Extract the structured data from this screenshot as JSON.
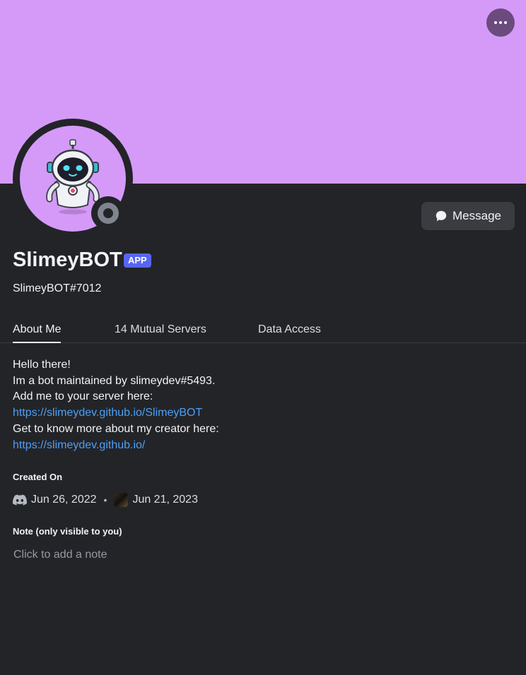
{
  "profile": {
    "display_name": "SlimeyBOT",
    "badge": "APP",
    "username": "SlimeyBOT#7012",
    "banner_color": "#d59af8",
    "status": "offline"
  },
  "actions": {
    "message_label": "Message",
    "more_icon": "ellipsis-icon"
  },
  "tabs": [
    {
      "label": "About Me",
      "active": true
    },
    {
      "label": "14 Mutual Servers",
      "active": false
    },
    {
      "label": "Data Access",
      "active": false
    }
  ],
  "about": {
    "line1": "Hello there!",
    "line2": "Im a bot maintained by slimeydev#5493.",
    "line3": "Add me to your server here:",
    "link1": "https://slimeydev.github.io/SlimeyBOT",
    "line4": "Get to know more about my creator here:",
    "link2": "https://slimeydev.github.io/"
  },
  "created": {
    "title": "Created On",
    "discord_date": "Jun 26, 2022",
    "server_date": "Jun 21, 2023"
  },
  "note": {
    "title": "Note (only visible to you)",
    "placeholder": "Click to add a note"
  },
  "colors": {
    "accent": "#5865f2",
    "link": "#4d9ff6",
    "background": "#232428"
  }
}
